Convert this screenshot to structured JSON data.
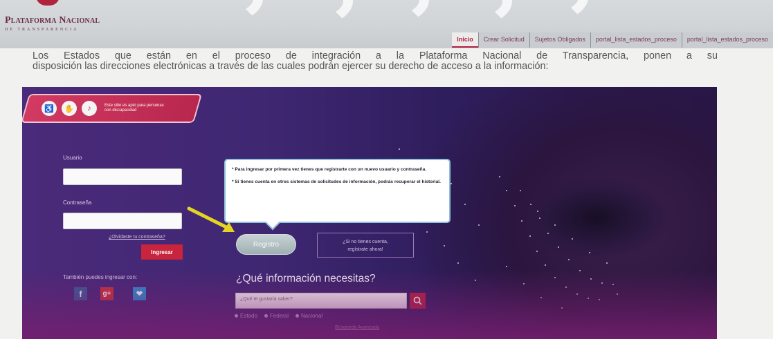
{
  "header": {
    "logo_title": "Plataforma Nacional",
    "logo_subtitle": "de Transparencia"
  },
  "nav": {
    "tabs": [
      {
        "label": "Inicio",
        "active": true
      },
      {
        "label": "Crear Solicitud"
      },
      {
        "label": "Sujetos Obligados"
      },
      {
        "label": "portal_lista_estados_proceso"
      },
      {
        "label": "portal_lista_estados_proceso"
      }
    ]
  },
  "intro": {
    "line1": "Los Estados que están en el proceso de integración a la Plataforma Nacional de Transparencia, ponen a su",
    "line2": "disposición las direcciones electrónicas a través de las cuales podrán ejercer su derecho de acceso a la información:"
  },
  "portal": {
    "accessibility": {
      "icons": [
        "wheelchair-icon",
        "sign-language-icon",
        "audio-icon"
      ],
      "text": "Este sitio es apto para personas con discapacidad"
    },
    "login": {
      "user_label": "Usuario",
      "password_label": "Contraseña",
      "forgot_link": "¿Olvidaste tu contraseña?",
      "submit_label": "Ingresar",
      "social_label": "También puedes ingresar con:",
      "social": [
        {
          "name": "facebook",
          "glyph": "f",
          "color": "#3b5998"
        },
        {
          "name": "google-plus",
          "glyph": "g+",
          "color": "#c8343b"
        },
        {
          "name": "twitter",
          "glyph": "t",
          "color": "#2a8fd0"
        }
      ]
    },
    "tooltip": {
      "line1": "* Para ingresar por primera vez tienes que registrarte con un nuevo usuario y contraseña.",
      "line2": "* Si tienes cuenta en otros sistemas de solicitudes de información, podrás recuperar el historial."
    },
    "register_label": "Registro",
    "no_account": {
      "line1": "¿Si no tienes cuenta,",
      "line2": "regístrate ahora!"
    },
    "search": {
      "question": "¿Qué información necesitas?",
      "placeholder": "¿Qué te gustaría saber?",
      "scopes": [
        "Estado",
        "Federal",
        "Nacional"
      ],
      "advanced_link": "Búsqueda Avanzada"
    }
  },
  "colors": {
    "brand": "#b51f3f",
    "portal_bg": "#3f2772",
    "arrow": "#e3d521"
  }
}
